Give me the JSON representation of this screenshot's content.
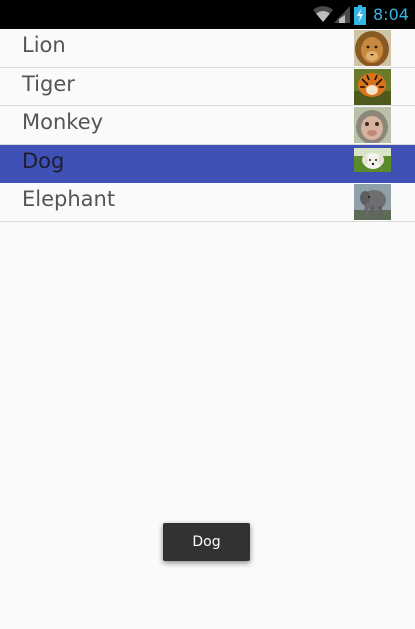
{
  "status_bar": {
    "time": "8:04",
    "icons": [
      "wifi-icon",
      "signal-icon",
      "battery-charging-icon"
    ],
    "accent_color": "#33b5e5"
  },
  "list": {
    "items": [
      {
        "label": "Lion",
        "thumbnail": "lion-photo",
        "selected": false
      },
      {
        "label": "Tiger",
        "thumbnail": "tiger-photo",
        "selected": false
      },
      {
        "label": "Monkey",
        "thumbnail": "monkey-photo",
        "selected": false
      },
      {
        "label": "Dog",
        "thumbnail": "dog-photo",
        "selected": true
      },
      {
        "label": "Elephant",
        "thumbnail": "elephant-photo",
        "selected": false
      }
    ],
    "selected_color": "#3f51b5"
  },
  "toast": {
    "text": "Dog"
  }
}
